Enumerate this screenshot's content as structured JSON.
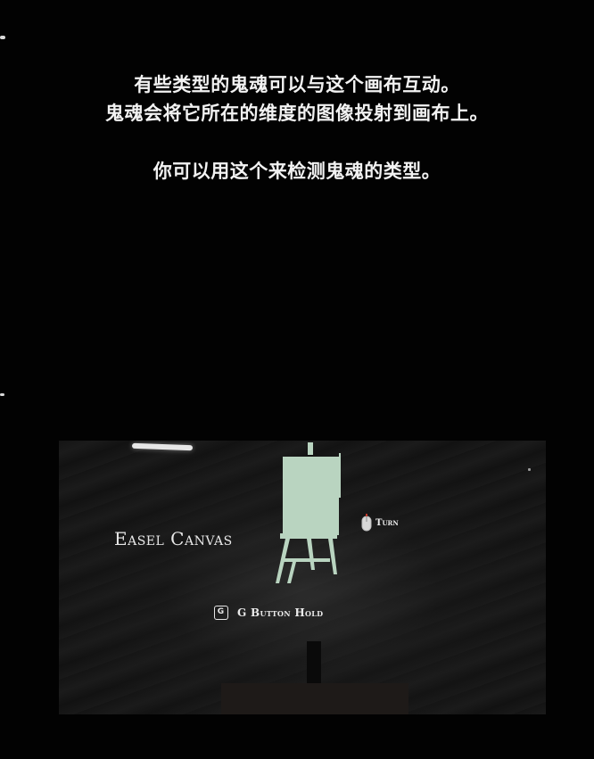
{
  "tutorial": {
    "line_1": "有些类型的鬼魂可以与这个画布互动。",
    "line_2": "鬼魂会将它所在的维度的图像投射到画布上。",
    "line_3": "你可以用这个来检测鬼魂的类型。"
  },
  "item_preview": {
    "object_name": "Easel Canvas",
    "object_icon": "easel-canvas-icon",
    "canvas_color": "#b9d4c0",
    "turn_hint": {
      "label": "Turn",
      "icon": "mouse-icon"
    },
    "pickup_hint": {
      "key": "G",
      "label": "G Button Hold",
      "icon": "key-g-icon"
    }
  },
  "colors": {
    "text": "#f2f2f2",
    "background": "#020202",
    "mouse_accent": "#c0392b"
  }
}
